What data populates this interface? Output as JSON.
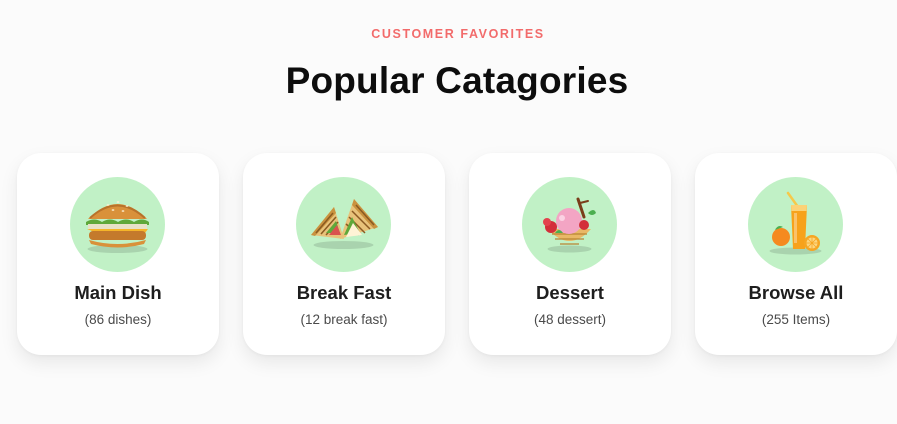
{
  "header": {
    "eyebrow": "CUSTOMER FAVORITES",
    "title": "Popular Catagories"
  },
  "colors": {
    "accent": "#f26b6b",
    "circle_bg": "#c1f1c6",
    "card_bg": "#ffffff",
    "page_bg": "#fbfbfb"
  },
  "categories": [
    {
      "name": "Main Dish",
      "count": "(86 dishes)",
      "icon": "burger-icon"
    },
    {
      "name": "Break Fast",
      "count": "(12 break fast)",
      "icon": "sandwich-icon"
    },
    {
      "name": "Dessert",
      "count": "(48 dessert)",
      "icon": "ice-cream-icon"
    },
    {
      "name": "Browse All",
      "count": "(255 Items)",
      "icon": "juice-icon"
    }
  ]
}
